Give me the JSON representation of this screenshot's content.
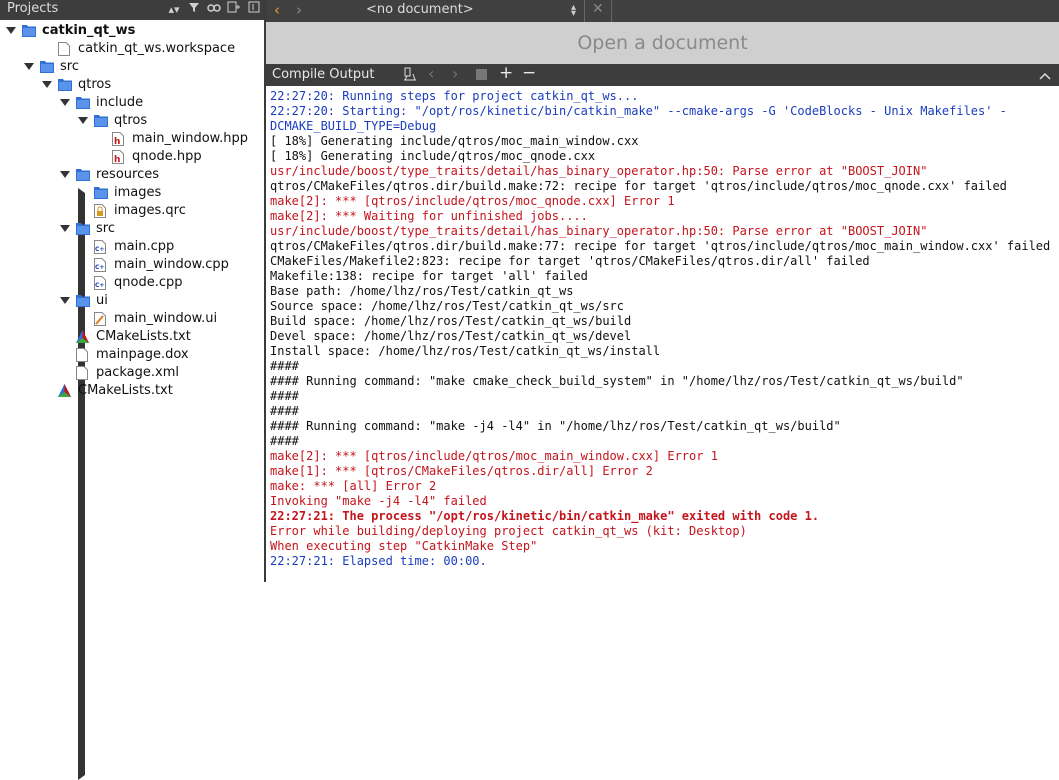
{
  "left_panel": {
    "title": "Projects",
    "tree": [
      {
        "label": "catkin_qt_ws",
        "indent": 0,
        "icon": "folder-icon",
        "arrow": "down",
        "bold": true
      },
      {
        "label": "catkin_qt_ws.workspace",
        "indent": 2,
        "icon": "file-icon",
        "arrow": "",
        "bold": false
      },
      {
        "label": "src",
        "indent": 1,
        "icon": "folder-icon",
        "arrow": "down",
        "bold": false
      },
      {
        "label": "qtros",
        "indent": 2,
        "icon": "folder-icon",
        "arrow": "down",
        "bold": false
      },
      {
        "label": "include",
        "indent": 3,
        "icon": "folder-icon",
        "arrow": "down",
        "bold": false
      },
      {
        "label": "qtros",
        "indent": 4,
        "icon": "folder-icon",
        "arrow": "down",
        "bold": false
      },
      {
        "label": "main_window.hpp",
        "indent": 5,
        "icon": "header-file-icon",
        "arrow": "",
        "bold": false
      },
      {
        "label": "qnode.hpp",
        "indent": 5,
        "icon": "header-file-icon",
        "arrow": "",
        "bold": false
      },
      {
        "label": "resources",
        "indent": 3,
        "icon": "folder-icon",
        "arrow": "down",
        "bold": false
      },
      {
        "label": "images",
        "indent": 4,
        "icon": "folder-icon",
        "arrow": "right",
        "bold": false
      },
      {
        "label": "images.qrc",
        "indent": 4,
        "icon": "resource-file-icon",
        "arrow": "",
        "bold": false
      },
      {
        "label": "src",
        "indent": 3,
        "icon": "folder-icon",
        "arrow": "down",
        "bold": false
      },
      {
        "label": "main.cpp",
        "indent": 4,
        "icon": "cpp-file-icon",
        "arrow": "",
        "bold": false
      },
      {
        "label": "main_window.cpp",
        "indent": 4,
        "icon": "cpp-file-icon",
        "arrow": "",
        "bold": false
      },
      {
        "label": "qnode.cpp",
        "indent": 4,
        "icon": "cpp-file-icon",
        "arrow": "",
        "bold": false
      },
      {
        "label": "ui",
        "indent": 3,
        "icon": "folder-icon",
        "arrow": "down",
        "bold": false
      },
      {
        "label": "main_window.ui",
        "indent": 4,
        "icon": "ui-file-icon",
        "arrow": "",
        "bold": false
      },
      {
        "label": "CMakeLists.txt",
        "indent": 3,
        "icon": "cmake-icon",
        "arrow": "",
        "bold": false
      },
      {
        "label": "mainpage.dox",
        "indent": 3,
        "icon": "file-icon",
        "arrow": "",
        "bold": false
      },
      {
        "label": "package.xml",
        "indent": 3,
        "icon": "file-icon",
        "arrow": "",
        "bold": false
      },
      {
        "label": "CMakeLists.txt",
        "indent": 2,
        "icon": "cmake-icon",
        "arrow": "",
        "bold": false
      }
    ]
  },
  "editor": {
    "document_selector": "<no document>",
    "placeholder": "Open a document"
  },
  "output_panel": {
    "title": "Compile Output",
    "lines": [
      {
        "text": "22:27:20: Running steps for project catkin_qt_ws...",
        "style": "c-blue"
      },
      {
        "text": "22:27:20: Starting: \"/opt/ros/kinetic/bin/catkin_make\" --cmake-args -G 'CodeBlocks - Unix Makefiles' -",
        "style": "c-blue"
      },
      {
        "text": "DCMAKE_BUILD_TYPE=Debug",
        "style": "c-blue"
      },
      {
        "text": "[ 18%] Generating include/qtros/moc_main_window.cxx",
        "style": "c-black"
      },
      {
        "text": "[ 18%] Generating include/qtros/moc_qnode.cxx",
        "style": "c-black"
      },
      {
        "text": "usr/include/boost/type_traits/detail/has_binary_operator.hp:50: Parse error at \"BOOST_JOIN\"",
        "style": "c-red"
      },
      {
        "text": "qtros/CMakeFiles/qtros.dir/build.make:72: recipe for target 'qtros/include/qtros/moc_qnode.cxx' failed",
        "style": "c-black"
      },
      {
        "text": "make[2]: *** [qtros/include/qtros/moc_qnode.cxx] Error 1",
        "style": "c-red"
      },
      {
        "text": "make[2]: *** Waiting for unfinished jobs....",
        "style": "c-red"
      },
      {
        "text": "usr/include/boost/type_traits/detail/has_binary_operator.hp:50: Parse error at \"BOOST_JOIN\"",
        "style": "c-red"
      },
      {
        "text": "qtros/CMakeFiles/qtros.dir/build.make:77: recipe for target 'qtros/include/qtros/moc_main_window.cxx' failed",
        "style": "c-black"
      },
      {
        "text": "CMakeFiles/Makefile2:823: recipe for target 'qtros/CMakeFiles/qtros.dir/all' failed",
        "style": "c-black"
      },
      {
        "text": "Makefile:138: recipe for target 'all' failed",
        "style": "c-black"
      },
      {
        "text": "Base path: /home/lhz/ros/Test/catkin_qt_ws",
        "style": "c-black"
      },
      {
        "text": "Source space: /home/lhz/ros/Test/catkin_qt_ws/src",
        "style": "c-black"
      },
      {
        "text": "Build space: /home/lhz/ros/Test/catkin_qt_ws/build",
        "style": "c-black"
      },
      {
        "text": "Devel space: /home/lhz/ros/Test/catkin_qt_ws/devel",
        "style": "c-black"
      },
      {
        "text": "Install space: /home/lhz/ros/Test/catkin_qt_ws/install",
        "style": "c-black"
      },
      {
        "text": "####",
        "style": "c-black"
      },
      {
        "text": "#### Running command: \"make cmake_check_build_system\" in \"/home/lhz/ros/Test/catkin_qt_ws/build\"",
        "style": "c-black"
      },
      {
        "text": "####",
        "style": "c-black"
      },
      {
        "text": "####",
        "style": "c-black"
      },
      {
        "text": "#### Running command: \"make -j4 -l4\" in \"/home/lhz/ros/Test/catkin_qt_ws/build\"",
        "style": "c-black"
      },
      {
        "text": "####",
        "style": "c-black"
      },
      {
        "text": "make[2]: *** [qtros/include/qtros/moc_main_window.cxx] Error 1",
        "style": "c-red"
      },
      {
        "text": "make[1]: *** [qtros/CMakeFiles/qtros.dir/all] Error 2",
        "style": "c-red"
      },
      {
        "text": "make: *** [all] Error 2",
        "style": "c-red"
      },
      {
        "text": "Invoking \"make -j4 -l4\" failed",
        "style": "c-red"
      },
      {
        "text": "22:27:21: The process \"/opt/ros/kinetic/bin/catkin_make\" exited with code 1.",
        "style": "c-boldred"
      },
      {
        "text": "Error while building/deploying project catkin_qt_ws (kit: Desktop)",
        "style": "c-red"
      },
      {
        "text": "When executing step \"CatkinMake Step\"",
        "style": "c-red"
      },
      {
        "text": "22:27:21: Elapsed time: 00:00.",
        "style": "c-blue"
      }
    ]
  }
}
